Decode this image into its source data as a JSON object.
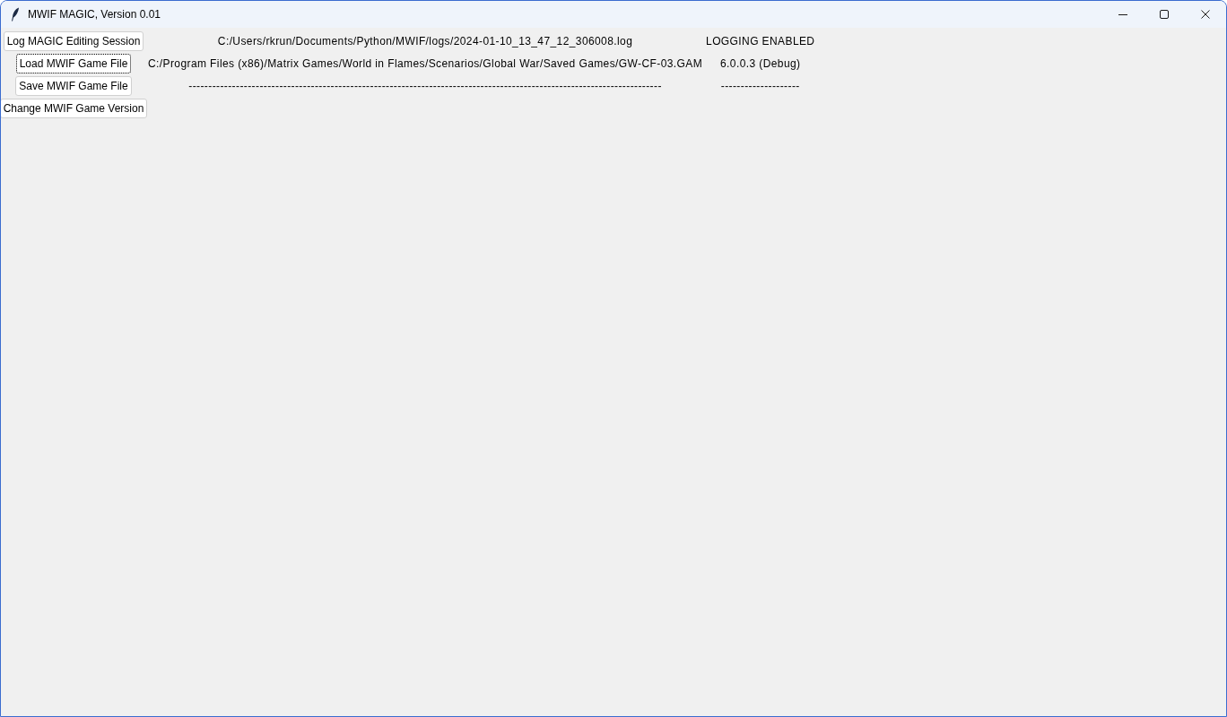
{
  "window": {
    "title": "MWIF MAGIC, Version 0.01"
  },
  "rows": [
    {
      "button": {
        "label": "Log MAGIC Editing Session",
        "focused": false
      },
      "column_2": "C:/Users/rkrun/Documents/Python/MWIF/logs/2024-01-10_13_47_12_306008.log",
      "column_3": "LOGGING ENABLED"
    },
    {
      "button": {
        "label": "Load MWIF Game File",
        "focused": true
      },
      "column_2": "C:/Program Files (x86)/Matrix Games/World in Flames/Scenarios/Global War/Saved Games/GW-CF-03.GAM",
      "column_3": "6.0.0.3 (Debug)"
    },
    {
      "button": {
        "label": "Save MWIF Game File",
        "focused": false
      },
      "column_2": "------------------------------------------------------------------------------------------------------------------------",
      "column_3": "--------------------"
    },
    {
      "button": {
        "label": "Change MWIF Game Version",
        "focused": false
      }
    }
  ]
}
